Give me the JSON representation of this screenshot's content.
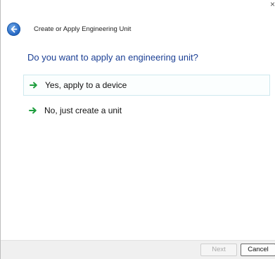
{
  "window": {
    "close_glyph": "×"
  },
  "header": {
    "title": "Create or Apply Engineering Unit",
    "back_icon": "back-arrow-icon"
  },
  "question": "Do you want to apply an engineering unit?",
  "options": [
    {
      "label": "Yes, apply to a device",
      "icon": "green-arrow-icon",
      "highlighted": true
    },
    {
      "label": "No, just create a unit",
      "icon": "green-arrow-icon",
      "highlighted": false
    }
  ],
  "footer": {
    "next_label": "Next",
    "cancel_label": "Cancel"
  },
  "colors": {
    "question_text": "#1b3f94",
    "arrow": "#1e9e3e",
    "back_button": "#2a6cc7"
  }
}
